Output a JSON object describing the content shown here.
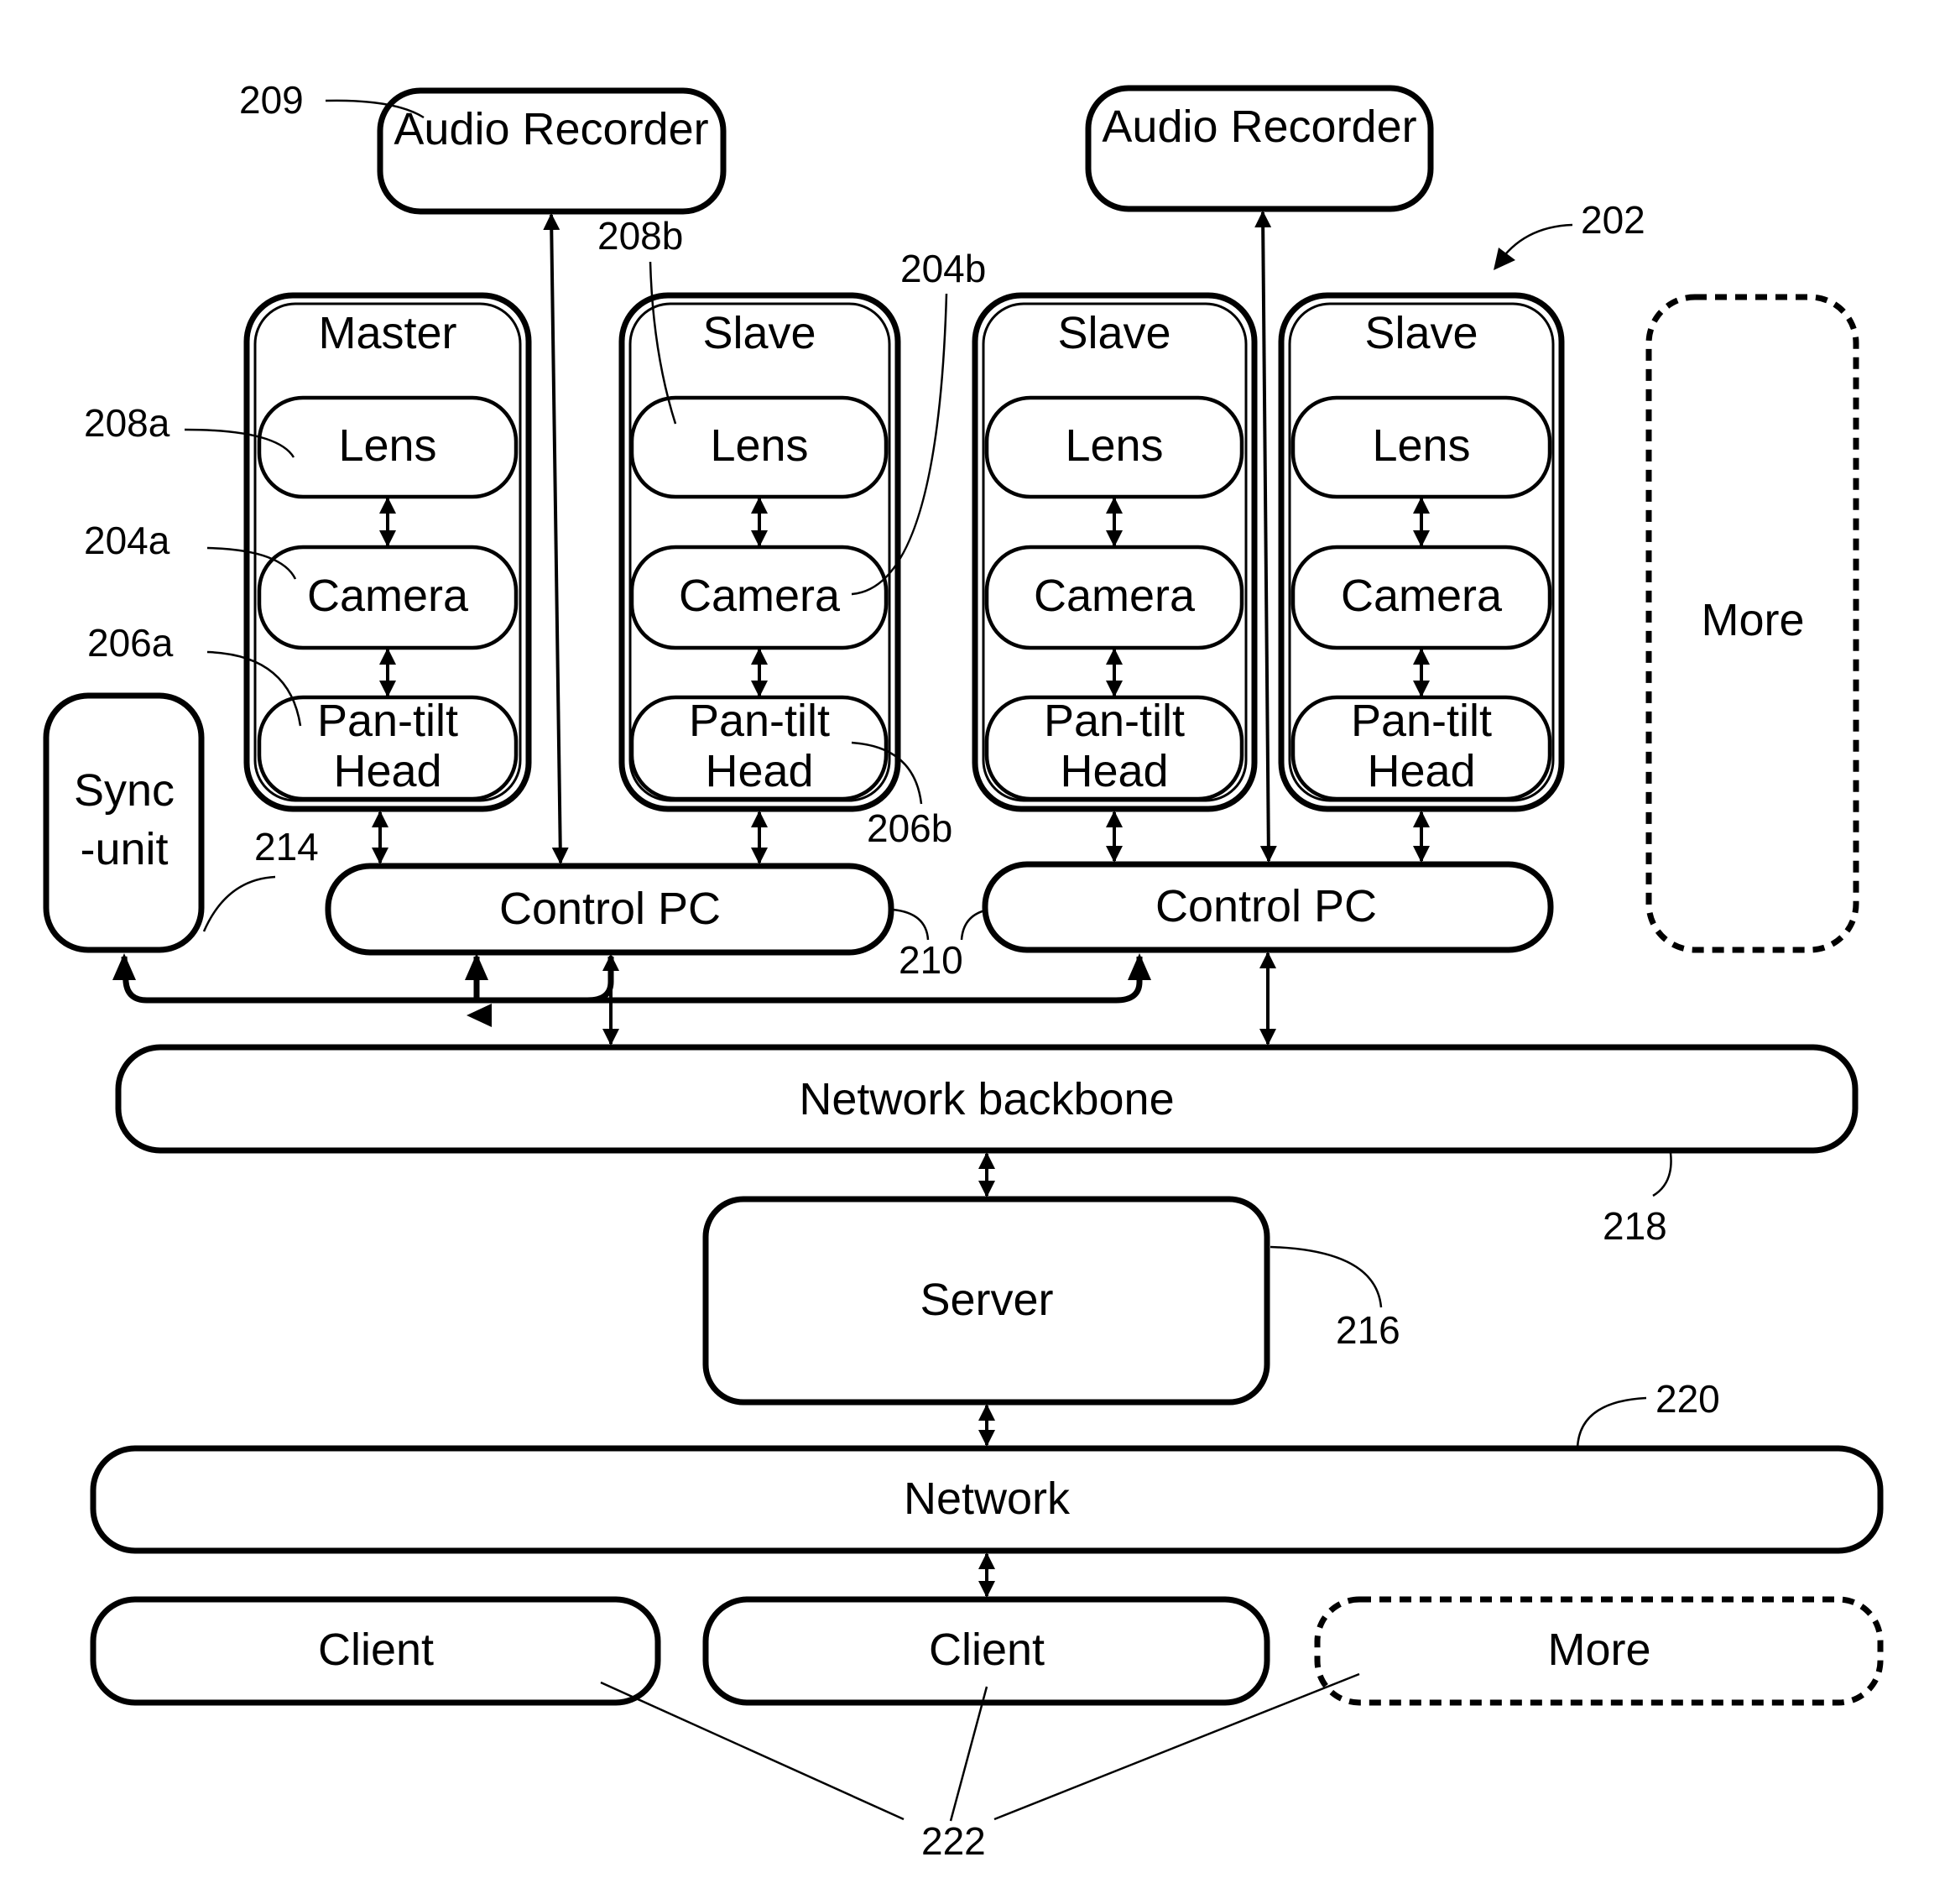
{
  "diagram": {
    "audio_recorders": [
      {
        "label": "Audio Recorder",
        "ref": "209"
      },
      {
        "label": "Audio Recorder"
      }
    ],
    "camera_units": [
      {
        "role": "Master",
        "lens": "Lens",
        "camera": "Camera",
        "pan_tilt": [
          "Pan-tilt",
          "Head"
        ]
      },
      {
        "role": "Slave",
        "lens": "Lens",
        "camera": "Camera",
        "pan_tilt": [
          "Pan-tilt",
          "Head"
        ]
      },
      {
        "role": "Slave",
        "lens": "Lens",
        "camera": "Camera",
        "pan_tilt": [
          "Pan-tilt",
          "Head"
        ]
      },
      {
        "role": "Slave",
        "lens": "Lens",
        "camera": "Camera",
        "pan_tilt": [
          "Pan-tilt",
          "Head"
        ]
      }
    ],
    "more_units_label": "More",
    "sync_unit": [
      "Sync",
      "-unit"
    ],
    "control_pcs": [
      "Control PC",
      "Control PC"
    ],
    "network_backbone": "Network backbone",
    "server": "Server",
    "network": "Network",
    "clients": [
      "Client",
      "Client"
    ],
    "more_clients_label": "More",
    "refs": {
      "r209": "209",
      "r208b": "208b",
      "r204b": "204b",
      "r202": "202",
      "r208a": "208a",
      "r204a": "204a",
      "r206a": "206a",
      "r206b": "206b",
      "r214": "214",
      "r210": "210",
      "r218": "218",
      "r216": "216",
      "r220": "220",
      "r222": "222"
    }
  }
}
